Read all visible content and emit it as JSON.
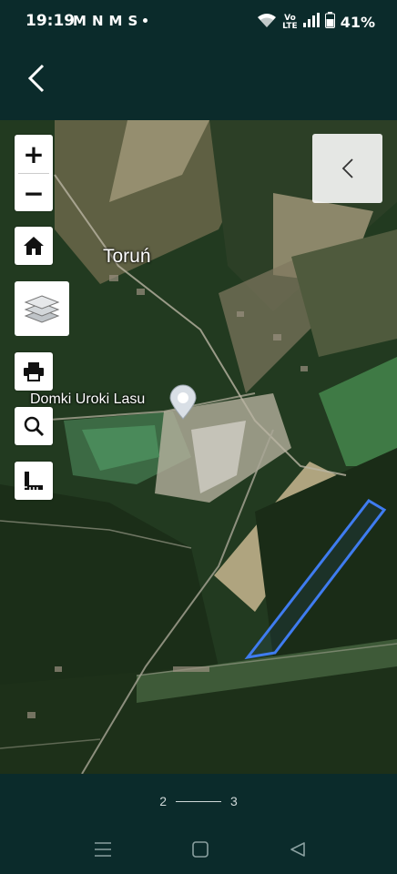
{
  "status_bar": {
    "time": "19:19",
    "notification_glyphs": [
      "M",
      "N",
      "M",
      "S"
    ],
    "volte_top": "Vo",
    "volte_bottom": "LTE",
    "battery": "41%"
  },
  "map": {
    "place_label": "Toruń",
    "poi_label": "Domki Uroki Lasu",
    "zoom_in_label": "+",
    "zoom_out_label": "−",
    "highlight_color": "#3f7cf0",
    "buttons": [
      "zoom-in",
      "zoom-out",
      "home",
      "layers",
      "print",
      "search",
      "measure",
      "collapse-panel"
    ]
  },
  "pager": {
    "current": "2",
    "total": "3"
  },
  "colors": {
    "background": "#0b2b2b",
    "button_bg": "#ffffff",
    "parcel_outline": "#3f7cf0"
  }
}
